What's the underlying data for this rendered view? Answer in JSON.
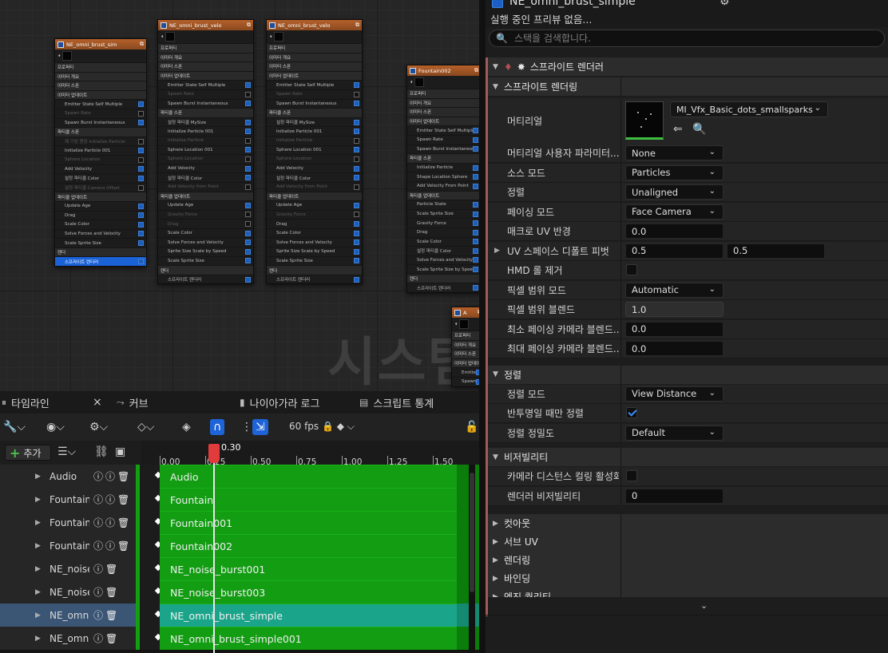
{
  "graph": {
    "watermark": "시스템",
    "nodes": [
      {
        "title": "NE_omni_brust_sim",
        "rows": [
          {
            "t": "프로퍼티",
            "k": "sec-sm"
          },
          {
            "t": "이미터 개요",
            "k": "sec"
          },
          {
            "t": "이미터 스폰",
            "k": "sec"
          },
          {
            "t": "이미터 업데이트",
            "k": "sec"
          },
          {
            "t": "Emitter State Self Multiple",
            "k": "on"
          },
          {
            "t": "Spawn Rate",
            "k": "dim"
          },
          {
            "t": "Spawn Burst Instantaneous",
            "k": "on"
          },
          {
            "t": "파티클 스폰",
            "k": "sec"
          },
          {
            "t": "제 기된 용된 Initialize Particle",
            "k": "dim"
          },
          {
            "t": "Initialize Particle 001",
            "k": "on"
          },
          {
            "t": "Sphere Location",
            "k": "dim"
          },
          {
            "t": "Add Velocity",
            "k": "on"
          },
          {
            "t": "설정 파티클 Color",
            "k": "on"
          },
          {
            "t": "설정 파티클 Camera Offset",
            "k": "dim"
          },
          {
            "t": "파티클 업데이트",
            "k": "sec"
          },
          {
            "t": "Update Age",
            "k": "on"
          },
          {
            "t": "Drag",
            "k": "on"
          },
          {
            "t": "Scale Color",
            "k": "on"
          },
          {
            "t": "Solve Forces and Velocity",
            "k": "on"
          },
          {
            "t": "Scale Sprite Size",
            "k": "on"
          },
          {
            "t": "렌더",
            "k": "sec"
          },
          {
            "t": "스프라이트 렌더러",
            "k": "sel"
          }
        ]
      },
      {
        "title": "NE_omni_brust_velo",
        "rows": [
          {
            "t": "프로퍼티",
            "k": "sec-sm"
          },
          {
            "t": "이미터 개요",
            "k": "sec"
          },
          {
            "t": "이미터 스폰",
            "k": "sec"
          },
          {
            "t": "이미터 업데이트",
            "k": "sec"
          },
          {
            "t": "Emitter State Self Multiple",
            "k": "on"
          },
          {
            "t": "Spawn Rate",
            "k": "dim"
          },
          {
            "t": "Spawn Burst Instantaneous",
            "k": "on"
          },
          {
            "t": "파티클 스폰",
            "k": "sec"
          },
          {
            "t": "설정 파티클 MySize",
            "k": "on"
          },
          {
            "t": "Initialize Particle 001",
            "k": "on"
          },
          {
            "t": "Initialize Particle",
            "k": "dim"
          },
          {
            "t": "Sphere Location 001",
            "k": "on"
          },
          {
            "t": "Sphere Location",
            "k": "dim"
          },
          {
            "t": "Add Velocity",
            "k": "on"
          },
          {
            "t": "설정 파티클 Color",
            "k": "on"
          },
          {
            "t": "Add Velocity from Point",
            "k": "dim"
          },
          {
            "t": "파티클 업데이트",
            "k": "sec"
          },
          {
            "t": "Update Age",
            "k": "on"
          },
          {
            "t": "Gravity Force",
            "k": "dim"
          },
          {
            "t": "Drag",
            "k": "dim"
          },
          {
            "t": "Scale Color",
            "k": "on"
          },
          {
            "t": "Solve Forces and Velocity",
            "k": "on"
          },
          {
            "t": "Sprite Size Scale by Speed",
            "k": "on"
          },
          {
            "t": "Scale Sprite Size",
            "k": "on"
          },
          {
            "t": "렌더",
            "k": "sec"
          },
          {
            "t": "스프라이트 렌더러",
            "k": "on"
          }
        ]
      },
      {
        "title": "NE_omni_brust_velo",
        "rows": [
          {
            "t": "프로퍼티",
            "k": "sec-sm"
          },
          {
            "t": "이미터 개요",
            "k": "sec"
          },
          {
            "t": "이미터 스폰",
            "k": "sec"
          },
          {
            "t": "이미터 업데이트",
            "k": "sec"
          },
          {
            "t": "Emitter State Self Multiple",
            "k": "on"
          },
          {
            "t": "Spawn Rate",
            "k": "dim"
          },
          {
            "t": "Spawn Burst Instantaneous",
            "k": "on"
          },
          {
            "t": "파티클 스폰",
            "k": "sec"
          },
          {
            "t": "설정 파티클 MySize",
            "k": "on"
          },
          {
            "t": "Initialize Particle 001",
            "k": "on"
          },
          {
            "t": "Initialize Particle",
            "k": "dim"
          },
          {
            "t": "Sphere Location 001",
            "k": "on"
          },
          {
            "t": "Sphere Location",
            "k": "dim"
          },
          {
            "t": "Add Velocity",
            "k": "on"
          },
          {
            "t": "설정 파티클 Color",
            "k": "on"
          },
          {
            "t": "Add Velocity from Point",
            "k": "dim"
          },
          {
            "t": "파티클 업데이트",
            "k": "sec"
          },
          {
            "t": "Update Age",
            "k": "on"
          },
          {
            "t": "Gravity Force",
            "k": "dim"
          },
          {
            "t": "Drag",
            "k": "on"
          },
          {
            "t": "Scale Color",
            "k": "on"
          },
          {
            "t": "Solve Forces and Velocity",
            "k": "on"
          },
          {
            "t": "Sprite Size Scale by Speed",
            "k": "on"
          },
          {
            "t": "Scale Sprite Size",
            "k": "on"
          },
          {
            "t": "렌더",
            "k": "sec"
          },
          {
            "t": "스프라이트 렌더러",
            "k": "on"
          }
        ]
      },
      {
        "title": "Fountain002",
        "rows": [
          {
            "t": "프로퍼티",
            "k": "sec-sm"
          },
          {
            "t": "이미터 개요",
            "k": "sec"
          },
          {
            "t": "이미터 스폰",
            "k": "sec"
          },
          {
            "t": "이미터 업데이트",
            "k": "sec"
          },
          {
            "t": "Emitter State Self Multiple",
            "k": "on"
          },
          {
            "t": "Spawn Rate",
            "k": "on"
          },
          {
            "t": "Spawn Burst Instantaneous",
            "k": "on"
          },
          {
            "t": "파티클 스폰",
            "k": "sec"
          },
          {
            "t": "Initialize Particle",
            "k": "on"
          },
          {
            "t": "Shape Location Sphere",
            "k": "on"
          },
          {
            "t": "Add Velocity From Point",
            "k": "on"
          },
          {
            "t": "파티클 업데이트",
            "k": "sec"
          },
          {
            "t": "Particle State",
            "k": "on"
          },
          {
            "t": "Scale Sprite Size",
            "k": "on"
          },
          {
            "t": "Gravity Force",
            "k": "on"
          },
          {
            "t": "Drag",
            "k": "on"
          },
          {
            "t": "Scale Color",
            "k": "on"
          },
          {
            "t": "설정 파티클 Color",
            "k": "on"
          },
          {
            "t": "Solve Forces and Velocity",
            "k": "on"
          },
          {
            "t": "Scale Sprite Size by Speed",
            "k": "on"
          },
          {
            "t": "렌더",
            "k": "sec"
          },
          {
            "t": "스프라이트 렌더러",
            "k": "on"
          }
        ]
      },
      {
        "title": "A",
        "rows": [
          {
            "t": "프로퍼티",
            "k": "sec-sm"
          },
          {
            "t": "이미터 개요",
            "k": "sec"
          },
          {
            "t": "이미터 스폰",
            "k": "sec"
          },
          {
            "t": "이미터 업데이트",
            "k": "sec"
          },
          {
            "t": "Emitter State",
            "k": "on"
          },
          {
            "t": "Spawn Burst",
            "k": "on"
          }
        ]
      }
    ]
  },
  "timeline": {
    "tabs": [
      {
        "label": "타임라인",
        "icon": "timeline-icon"
      },
      {
        "label": "커브",
        "icon": "curve-icon"
      },
      {
        "label": "나이아가라 로그",
        "icon": "log-icon"
      },
      {
        "label": "스크립트 통계",
        "icon": "stats-icon"
      }
    ],
    "close": "×",
    "fps": "60 fps",
    "add_label": "추가",
    "playhead": "0.30",
    "ticks": [
      "0.00",
      "0.25",
      "0.50",
      "0.75",
      "1.00",
      "1.25",
      "1.50"
    ],
    "tracks": [
      {
        "name": "Audio",
        "bar": "Audio",
        "selected": false
      },
      {
        "name": "Fountain",
        "bar": "Fountain",
        "selected": false
      },
      {
        "name": "Fountain001",
        "bar": "Fountain001",
        "selected": false
      },
      {
        "name": "Fountain002",
        "bar": "Fountain002",
        "selected": false
      },
      {
        "name": "NE_noise_burst001",
        "bar": "NE_noise_burst001",
        "selected": false
      },
      {
        "name": "NE_noise_burst003",
        "bar": "NE_noise_burst003",
        "selected": false
      },
      {
        "name": "NE_omni_brust_simple",
        "bar": "NE_omni_brust_simple",
        "selected": true
      },
      {
        "name": "NE_omni_brust_simple001",
        "bar": "NE_omni_brust_simple001",
        "selected": false
      }
    ]
  },
  "details": {
    "emitter_name": "NE_omni_brust_simple",
    "no_preview": "실행 중인 프리뷰 없음...",
    "search_placeholder": "스택을 검색합니다.",
    "renderer_header": "스프라이트 렌더러",
    "section_sprite": "스프라이트 렌더링",
    "material_label": "머티리얼",
    "material_value": "MI_Vfx_Basic_dots_smallsparks",
    "rows": [
      {
        "label": "머티리얼 사용자 파라미터...",
        "type": "dropdown",
        "value": "None"
      },
      {
        "label": "소스 모드",
        "type": "dropdown",
        "value": "Particles"
      },
      {
        "label": "정렬",
        "type": "dropdown",
        "value": "Unaligned"
      },
      {
        "label": "페이싱 모드",
        "type": "dropdown",
        "value": "Face Camera"
      },
      {
        "label": "매크로 UV 반경",
        "type": "number",
        "value": "0.0"
      },
      {
        "label": "UV 스페이스 디폴트 피벗",
        "type": "vec2",
        "value": "0.5",
        "value2": "0.5"
      },
      {
        "label": "HMD 롤 제거",
        "type": "check",
        "checked": false
      },
      {
        "label": "픽셀 범위 모드",
        "type": "dropdown",
        "value": "Automatic"
      },
      {
        "label": "픽셀 범위 블렌드",
        "type": "number-dis",
        "value": "1.0"
      },
      {
        "label": "최소 페이싱 카메라 블렌드...",
        "type": "number",
        "value": "0.0"
      },
      {
        "label": "최대 페이싱 카메라 블렌드...",
        "type": "number",
        "value": "0.0"
      }
    ],
    "section_sort": "정렬",
    "sort_rows": [
      {
        "label": "정렬 모드",
        "type": "dropdown",
        "value": "View Distance"
      },
      {
        "label": "반투명일 때만 정렬",
        "type": "check",
        "checked": true
      },
      {
        "label": "정렬 정밀도",
        "type": "dropdown",
        "value": "Default"
      }
    ],
    "section_visibility": "비저빌리티",
    "vis_rows": [
      {
        "label": "카메라 디스턴스 컬링 활성화",
        "type": "check",
        "checked": false
      },
      {
        "label": "렌더러 비저빌리티",
        "type": "number",
        "value": "0"
      }
    ],
    "collapsed_sections": [
      "컷아웃",
      "서브 UV",
      "렌더링",
      "바인딩",
      "엔진 퀄리티"
    ]
  }
}
